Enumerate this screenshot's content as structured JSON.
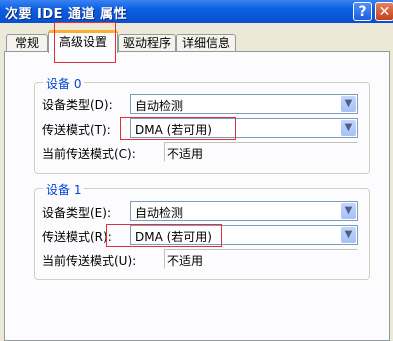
{
  "window": {
    "title": "次要 IDE 通道 属性"
  },
  "tabs": [
    {
      "label": "常规",
      "active": false
    },
    {
      "label": "高级设置",
      "active": true
    },
    {
      "label": "驱动程序",
      "active": false
    },
    {
      "label": "详细信息",
      "active": false
    }
  ],
  "device0": {
    "title": "设备 0",
    "type_label": "设备类型(D):",
    "type_value": "自动检测",
    "mode_label": "传送模式(T):",
    "mode_value": "DMA (若可用)",
    "current_label": "当前传送模式(C):",
    "current_value": "不适用"
  },
  "device1": {
    "title": "设备 1",
    "type_label": "设备类型(E):",
    "type_value": "自动检测",
    "mode_label": "传送模式(R):",
    "mode_value": "DMA (若可用)",
    "current_label": "当前传送模式(U):",
    "current_value": "不适用"
  },
  "colors": {
    "annotation": "#e0303a",
    "titlebar": "#0b5fe0",
    "group_title": "#0046d5"
  },
  "icons": {
    "help": "question-icon",
    "close": "close-icon",
    "dropdown": "chevron-down-icon"
  }
}
